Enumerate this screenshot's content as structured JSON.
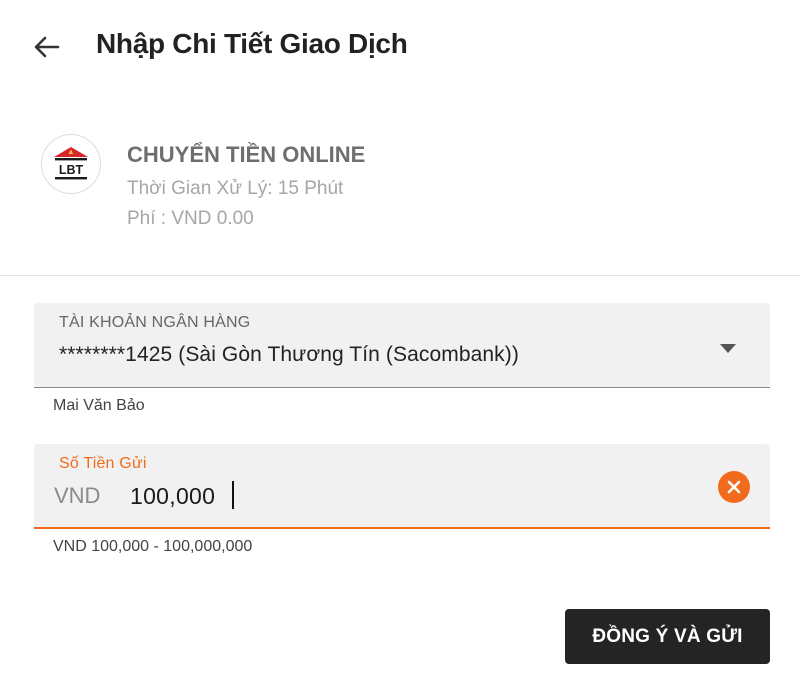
{
  "header": {
    "back_icon": "arrow-left-icon",
    "title": "Nhập Chi Tiết Giao Dịch"
  },
  "method": {
    "logo_icon": "lbt-bank-logo",
    "logo_text": "LBT",
    "name": "CHUYỂN TIỀN ONLINE",
    "processing_time": "Thời Gian Xử Lý: 15 Phút",
    "fee": "Phí : VND 0.00"
  },
  "bank_account": {
    "label": "TÀI KHOẢN NGÂN HÀNG",
    "value": "********1425 (Sài Gòn Thương Tín (Sacombank))",
    "holder": "Mai Văn Bảo",
    "dropdown_icon": "caret-down-icon"
  },
  "amount": {
    "label": "Số Tiền Gửi",
    "currency": "VND",
    "value": "100,000",
    "range_hint": "VND 100,000 - 100,000,000",
    "clear_icon": "clear-x-icon"
  },
  "submit": {
    "label": "ĐỒNG Ý VÀ GỬI"
  },
  "colors": {
    "accent": "#f26b1d",
    "button_bg": "#242424",
    "field_bg": "#f1f1f1",
    "muted_text": "#a6a6a6"
  }
}
